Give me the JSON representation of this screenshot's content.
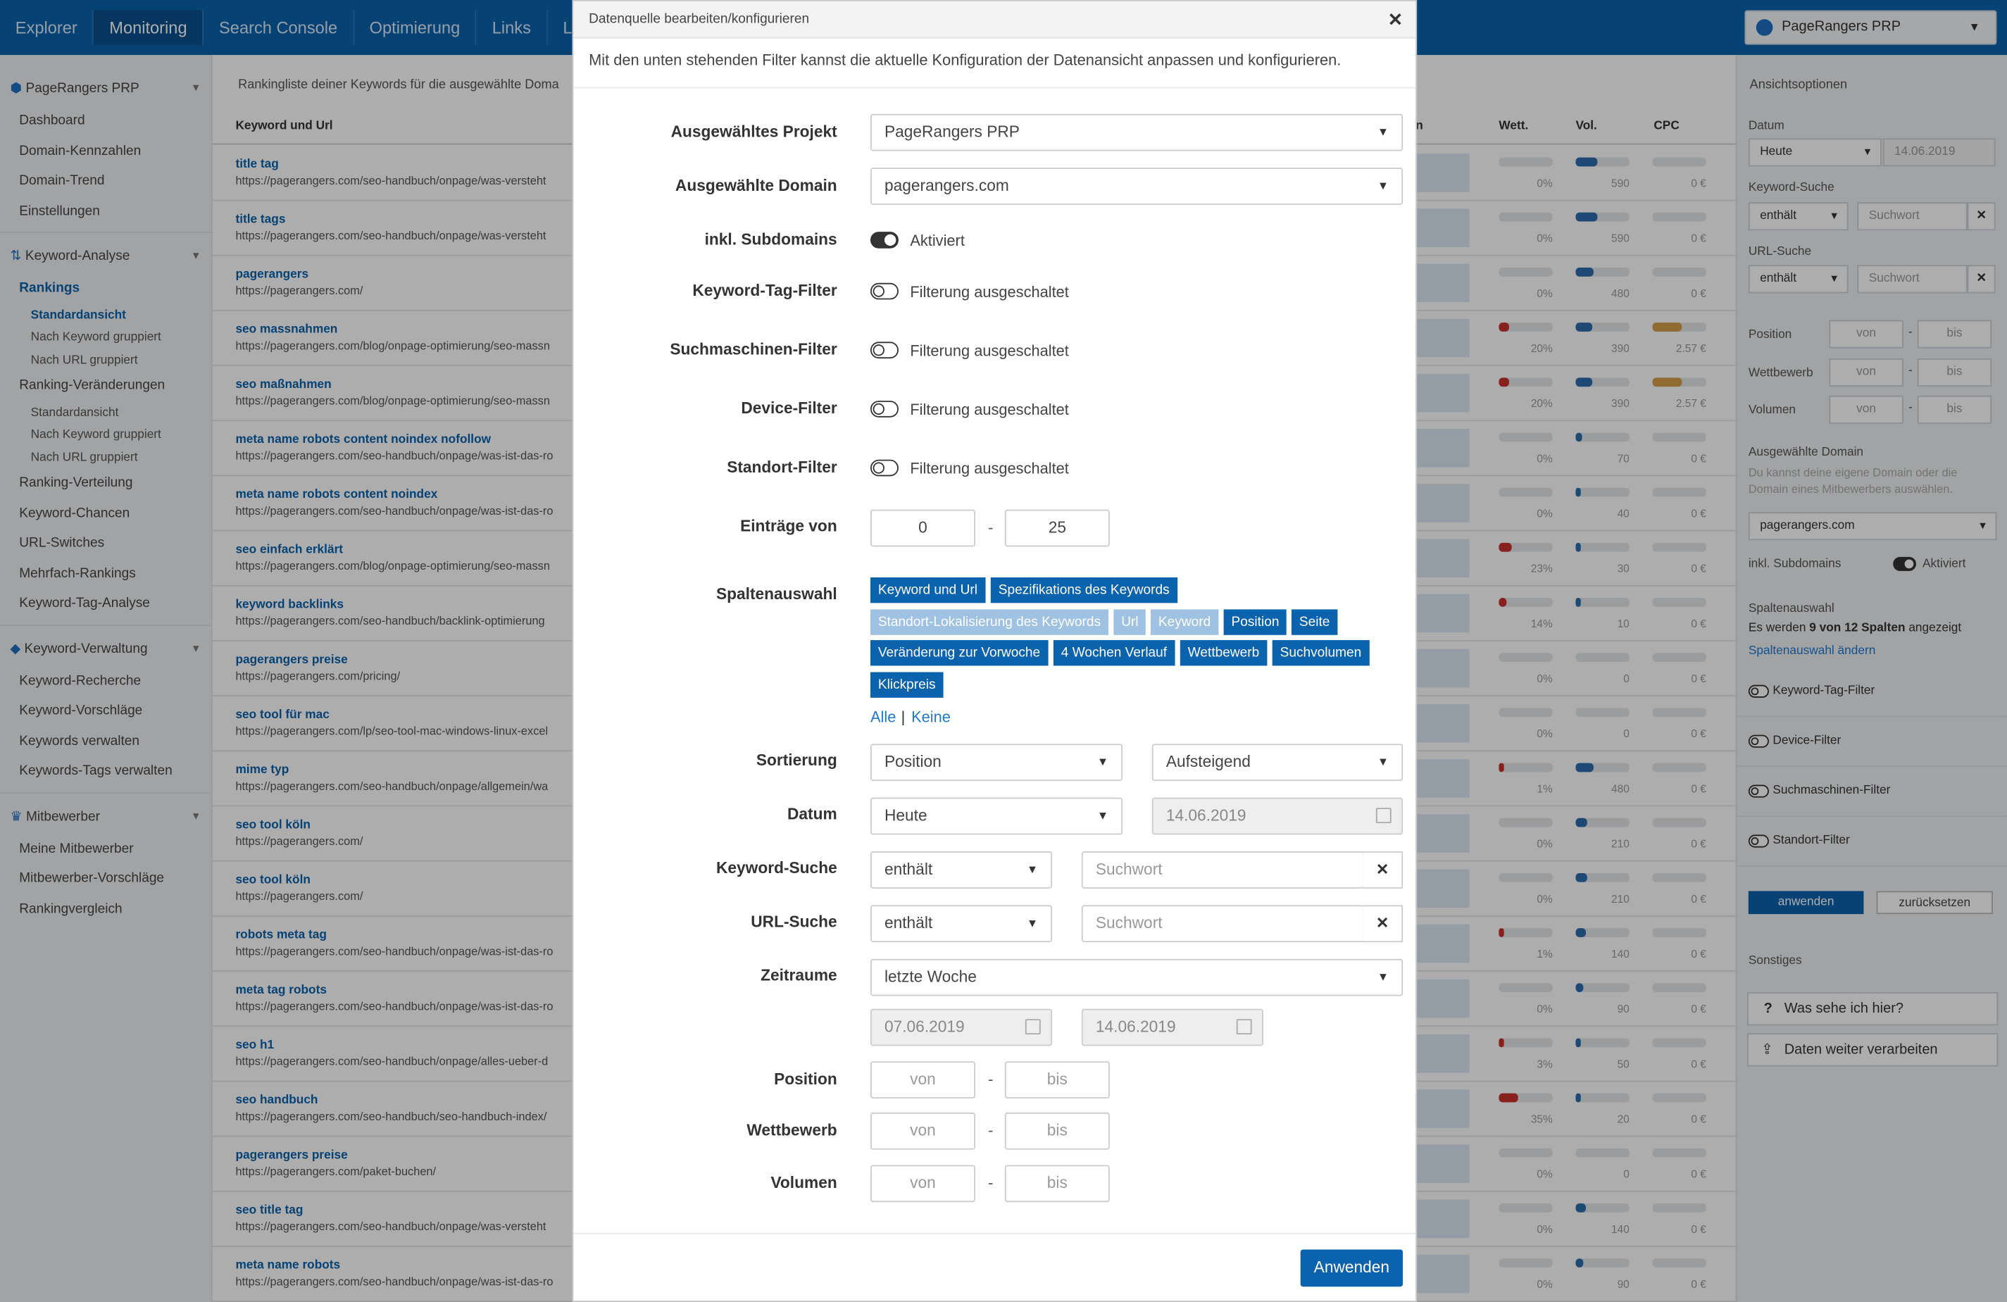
{
  "topnav": {
    "items": [
      "Explorer",
      "Monitoring",
      "Search Console",
      "Optimierung",
      "Links",
      "Lan"
    ],
    "project": "PageRangers PRP"
  },
  "leftnav": {
    "project": "PageRangers PRP",
    "main_items": [
      "Dashboard",
      "Domain-Kennzahlen",
      "Domain-Trend",
      "Einstellungen"
    ],
    "keyword_analyse": "Keyword-Analyse",
    "rankings": "Rankings",
    "rankings_sub": [
      "Standardansicht",
      "Nach Keyword gruppiert",
      "Nach URL gruppiert"
    ],
    "ranking_changes": "Ranking-Veränderungen",
    "ranking_changes_sub": [
      "Standardansicht",
      "Nach Keyword gruppiert",
      "Nach URL gruppiert"
    ],
    "analyse_items": [
      "Ranking-Verteilung",
      "Keyword-Chancen",
      "URL-Switches",
      "Mehrfach-Rankings",
      "Keyword-Tag-Analyse"
    ],
    "keyword_verwaltung": "Keyword-Verwaltung",
    "verwaltung_items": [
      "Keyword-Recherche",
      "Keyword-Vorschläge",
      "Keywords verwalten",
      "Keywords-Tags verwalten"
    ],
    "mitbewerber": "Mitbewerber",
    "mitbewerber_items": [
      "Meine Mitbewerber",
      "Mitbewerber-Vorschläge",
      "Rankingvergleich"
    ]
  },
  "table": {
    "caption": "Rankingliste deiner Keywords für die ausgewählte Doma",
    "col_keyword": "Keyword und Url",
    "col_n": "n",
    "col_wett": "Wett.",
    "col_vol": "Vol.",
    "col_cpc": "CPC",
    "rows": [
      {
        "kw": "title tag",
        "url": "https://pagerangers.com/seo-handbuch/onpage/was-versteht",
        "wett": "0%",
        "wett_pct": 0,
        "vol": "590",
        "vol_pct": 40,
        "cpc": "0 €",
        "cpc_pct": 0
      },
      {
        "kw": "title tags",
        "url": "https://pagerangers.com/seo-handbuch/onpage/was-versteht",
        "wett": "0%",
        "wett_pct": 0,
        "vol": "590",
        "vol_pct": 40,
        "cpc": "0 €",
        "cpc_pct": 0
      },
      {
        "kw": "pagerangers",
        "url": "https://pagerangers.com/",
        "wett": "0%",
        "wett_pct": 0,
        "vol": "480",
        "vol_pct": 33,
        "cpc": "0 €",
        "cpc_pct": 0
      },
      {
        "kw": "seo massnahmen",
        "url": "https://pagerangers.com/blog/onpage-optimierung/seo-massn",
        "wett": "20%",
        "wett_pct": 20,
        "vol": "390",
        "vol_pct": 30,
        "cpc": "2.57 €",
        "cpc_pct": 55
      },
      {
        "kw": "seo maßnahmen",
        "url": "https://pagerangers.com/blog/onpage-optimierung/seo-massn",
        "wett": "20%",
        "wett_pct": 20,
        "vol": "390",
        "vol_pct": 30,
        "cpc": "2.57 €",
        "cpc_pct": 55
      },
      {
        "kw": "meta name robots content noindex nofollow",
        "url": "https://pagerangers.com/seo-handbuch/onpage/was-ist-das-ro",
        "wett": "0%",
        "wett_pct": 0,
        "vol": "70",
        "vol_pct": 12,
        "cpc": "0 €",
        "cpc_pct": 0
      },
      {
        "kw": "meta name robots content noindex",
        "url": "https://pagerangers.com/seo-handbuch/onpage/was-ist-das-ro",
        "wett": "0%",
        "wett_pct": 0,
        "vol": "40",
        "vol_pct": 8,
        "cpc": "0 €",
        "cpc_pct": 0
      },
      {
        "kw": "seo einfach erklärt",
        "url": "https://pagerangers.com/blog/onpage-optimierung/seo-massn",
        "wett": "23%",
        "wett_pct": 23,
        "vol": "30",
        "vol_pct": 6,
        "cpc": "0 €",
        "cpc_pct": 0
      },
      {
        "kw": "keyword backlinks",
        "url": "https://pagerangers.com/seo-handbuch/backlink-optimierung",
        "wett": "14%",
        "wett_pct": 14,
        "vol": "10",
        "vol_pct": 3,
        "cpc": "0 €",
        "cpc_pct": 0
      },
      {
        "kw": "pagerangers preise",
        "url": "https://pagerangers.com/pricing/",
        "wett": "0%",
        "wett_pct": 0,
        "vol": "0",
        "vol_pct": 0,
        "cpc": "0 €",
        "cpc_pct": 0
      },
      {
        "kw": "seo tool für mac",
        "url": "https://pagerangers.com/lp/seo-tool-mac-windows-linux-excel",
        "wett": "0%",
        "wett_pct": 0,
        "vol": "0",
        "vol_pct": 0,
        "cpc": "0 €",
        "cpc_pct": 0
      },
      {
        "kw": "mime typ",
        "url": "https://pagerangers.com/seo-handbuch/onpage/allgemein/wa",
        "wett": "1%",
        "wett_pct": 1,
        "vol": "480",
        "vol_pct": 33,
        "cpc": "0 €",
        "cpc_pct": 0
      },
      {
        "kw": "seo tool köln",
        "url": "https://pagerangers.com/",
        "wett": "0%",
        "wett_pct": 0,
        "vol": "210",
        "vol_pct": 22,
        "cpc": "0 €",
        "cpc_pct": 0
      },
      {
        "kw": "seo tool köln",
        "url": "https://pagerangers.com/",
        "wett": "0%",
        "wett_pct": 0,
        "vol": "210",
        "vol_pct": 22,
        "cpc": "0 €",
        "cpc_pct": 0
      },
      {
        "kw": "robots meta tag",
        "url": "https://pagerangers.com/seo-handbuch/onpage/was-ist-das-ro",
        "wett": "1%",
        "wett_pct": 1,
        "vol": "140",
        "vol_pct": 18,
        "cpc": "0 €",
        "cpc_pct": 0
      },
      {
        "kw": "meta tag robots",
        "url": "https://pagerangers.com/seo-handbuch/onpage/was-ist-das-ro",
        "wett": "0%",
        "wett_pct": 0,
        "vol": "90",
        "vol_pct": 14,
        "cpc": "0 €",
        "cpc_pct": 0
      },
      {
        "kw": "seo h1",
        "url": "https://pagerangers.com/seo-handbuch/onpage/alles-ueber-d",
        "wett": "3%",
        "wett_pct": 3,
        "vol": "50",
        "vol_pct": 9,
        "cpc": "0 €",
        "cpc_pct": 0
      },
      {
        "kw": "seo handbuch",
        "url": "https://pagerangers.com/seo-handbuch/seo-handbuch-index/",
        "wett": "35%",
        "wett_pct": 35,
        "vol": "20",
        "vol_pct": 5,
        "cpc": "0 €",
        "cpc_pct": 0
      },
      {
        "kw": "pagerangers preise",
        "url": "https://pagerangers.com/paket-buchen/",
        "wett": "0%",
        "wett_pct": 0,
        "vol": "0",
        "vol_pct": 0,
        "cpc": "0 €",
        "cpc_pct": 0
      },
      {
        "kw": "seo title tag",
        "url": "https://pagerangers.com/seo-handbuch/onpage/was-versteht",
        "wett": "0%",
        "wett_pct": 0,
        "vol": "140",
        "vol_pct": 18,
        "cpc": "0 €",
        "cpc_pct": 0
      },
      {
        "kw": "meta name robots",
        "url": "https://pagerangers.com/seo-handbuch/onpage/was-ist-das-ro",
        "wett": "0%",
        "wett_pct": 0,
        "vol": "90",
        "vol_pct": 14,
        "cpc": "0 €",
        "cpc_pct": 0
      }
    ]
  },
  "right": {
    "title": "Ansichtsoptionen",
    "datum_label": "Datum",
    "datum_select": "Heute",
    "datum_value": "14.06.2019",
    "kw_label": "Keyword-Suche",
    "kw_select": "enthält",
    "kw_placeholder": "Suchwort",
    "url_label": "URL-Suche",
    "url_select": "enthält",
    "url_placeholder": "Suchwort",
    "position_label": "Position",
    "wett_label": "Wettbewerb",
    "vol_label": "Volumen",
    "from": "von",
    "to": "bis",
    "dash": "-",
    "domain_label": "Ausgewählte Domain",
    "domain_hint": "Du kannst deine eigene Domain oder die Domain eines Mitbewerbers auswählen.",
    "domain_value": "pagerangers.com",
    "sub_label": "inkl. Subdomains",
    "sub_state": "Aktiviert",
    "cols_label": "Spaltenauswahl",
    "cols_text_a": "Es werden",
    "cols_text_b": "9 von 12 Spalten",
    "cols_text_c": "angezeigt",
    "cols_link": "Spaltenauswahl ändern",
    "filters": [
      "Keyword-Tag-Filter",
      "Device-Filter",
      "Suchmaschinen-Filter",
      "Standort-Filter"
    ],
    "apply": "anwenden",
    "reset": "zurücksetzen",
    "misc_label": "Sonstiges",
    "help": "Was sehe ich hier?",
    "export": "Daten weiter verarbeiten"
  },
  "modal": {
    "title": "Datenquelle bearbeiten/konfigurieren",
    "description": "Mit den unten stehenden Filter kannst die aktuelle Konfiguration der Datenansicht anpassen und konfigurieren.",
    "project_label": "Ausgewähltes Projekt",
    "project_value": "PageRangers PRP",
    "domain_label": "Ausgewählte Domain",
    "domain_value": "pagerangers.com",
    "subdomains_label": "inkl. Subdomains",
    "subdomains_state": "Aktiviert",
    "filters": [
      {
        "label": "Keyword-Tag-Filter",
        "state": "Filterung ausgeschaltet"
      },
      {
        "label": "Suchmaschinen-Filter",
        "state": "Filterung ausgeschaltet"
      },
      {
        "label": "Device-Filter",
        "state": "Filterung ausgeschaltet"
      },
      {
        "label": "Standort-Filter",
        "state": "Filterung ausgeschaltet"
      }
    ],
    "entries_label": "Einträge von",
    "entries_from": "0",
    "entries_to": "25",
    "dash": "-",
    "columns_label": "Spaltenauswahl",
    "columns": [
      {
        "label": "Keyword und Url",
        "active": true
      },
      {
        "label": "Spezifikations des Keywords",
        "active": true
      },
      {
        "label": "Standort-Lokalisierung des Keywords",
        "active": false
      },
      {
        "label": "Url",
        "active": false
      },
      {
        "label": "Keyword",
        "active": false
      },
      {
        "label": "Position",
        "active": true
      },
      {
        "label": "Seite",
        "active": true
      },
      {
        "label": "Veränderung zur Vorwoche",
        "active": true
      },
      {
        "label": "4 Wochen Verlauf",
        "active": true
      },
      {
        "label": "Wettbewerb",
        "active": true
      },
      {
        "label": "Suchvolumen",
        "active": true
      },
      {
        "label": "Klickpreis",
        "active": true
      }
    ],
    "all": "Alle",
    "sep": "|",
    "none": "Keine",
    "sort_label": "Sortierung",
    "sort_field": "Position",
    "sort_dir": "Aufsteigend",
    "date_label": "Datum",
    "date_select": "Heute",
    "date_value": "14.06.2019",
    "kw_label": "Keyword-Suche",
    "kw_select": "enthält",
    "kw_placeholder": "Suchwort",
    "url_label": "URL-Suche",
    "url_select": "enthält",
    "url_placeholder": "Suchwort",
    "range_label": "Zeitraume",
    "range_value": "letzte Woche",
    "range_from": "07.06.2019",
    "range_to": "14.06.2019",
    "position_label": "Position",
    "wett_label": "Wettbewerb",
    "vol_label": "Volumen",
    "from": "von",
    "to": "bis",
    "apply": "Anwenden"
  }
}
